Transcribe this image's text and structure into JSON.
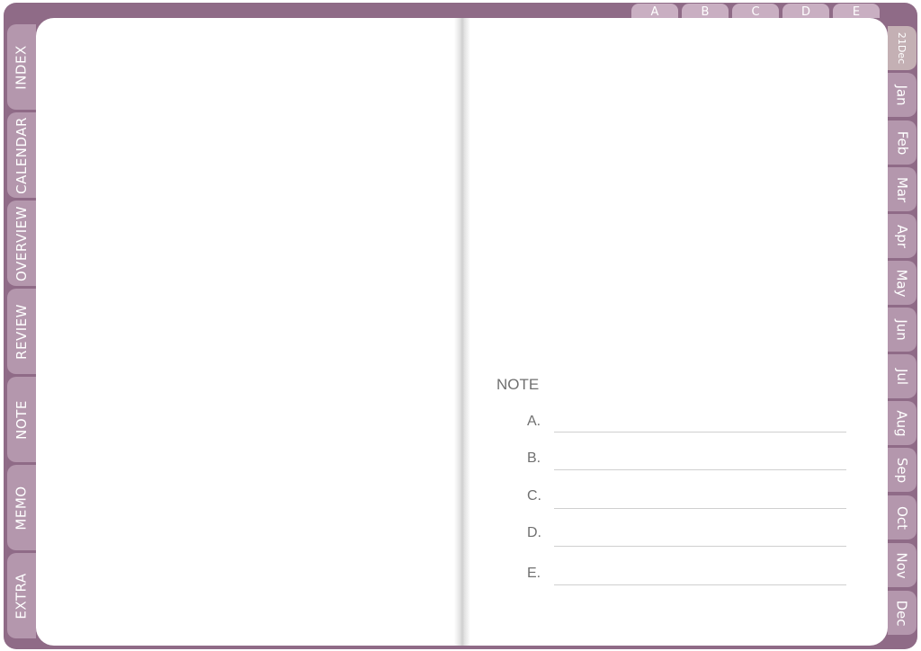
{
  "colors": {
    "cover": "#8f6b87",
    "tab": "#b497ad",
    "tab_active": "#c4b0b4",
    "top_tab": "#c9afc2",
    "page": "#ffffff",
    "note_text": "#6f6f6f"
  },
  "top_tabs": [
    "A",
    "B",
    "C",
    "D",
    "E"
  ],
  "left_tabs": [
    "INDEX",
    "CALENDAR",
    "OVERVIEW",
    "REVIEW",
    "NOTE",
    "MEMO",
    "EXTRA"
  ],
  "right_tabs": [
    "21Dec",
    "Jan",
    "Feb",
    "Mar",
    "Apr",
    "May",
    "Jun",
    "Jul",
    "Aug",
    "Sep",
    "Oct",
    "Nov",
    "Dec"
  ],
  "active_right_tab": "21Dec",
  "note": {
    "title": "NOTE",
    "labels": [
      "A.",
      "B.",
      "C.",
      "D.",
      "E."
    ]
  }
}
